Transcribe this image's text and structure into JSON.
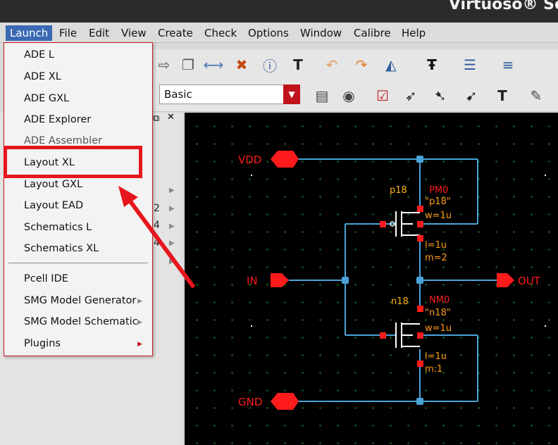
{
  "window": {
    "title": "Virtuoso® Sc"
  },
  "menubar": [
    "Launch",
    "File",
    "Edit",
    "View",
    "Create",
    "Check",
    "Options",
    "Window",
    "Calibre",
    "Help"
  ],
  "toolbar": {
    "filter_combo": "Basic"
  },
  "launch_menu": {
    "items": [
      "ADE L",
      "ADE XL",
      "ADE GXL",
      "ADE Explorer",
      "ADE Assembler",
      "Layout XL",
      "Layout GXL",
      "Layout EAD",
      "Schematics L",
      "Schematics XL",
      "Pcell IDE",
      "SMG Model Generator",
      "SMG Model Schematic",
      "Plugins"
    ],
    "highlighted": "Layout XL"
  },
  "left_pane": {
    "visible_numbers": [
      "2",
      "4",
      "4"
    ]
  },
  "schematic": {
    "pins": {
      "vdd": "VDD",
      "in": "IN",
      "out": "OUT",
      "gnd": "GND"
    },
    "pmos": {
      "model": "p18",
      "instance": "PM0",
      "cell": "\"p18\"",
      "width": "w=1u",
      "length": "l=1u",
      "mult": "m=2"
    },
    "nmos": {
      "model": "n18",
      "instance": "NM0",
      "cell": "\"n18\"",
      "width": "w=1u",
      "length": "l=1u",
      "mult": "m:1"
    }
  },
  "colors": {
    "accent_red": "#e8151d",
    "wire": "#4aa3d8",
    "pin_red": "#ff1b1b",
    "label_orange": "#ff9a1a",
    "grid": "#1b8a2a",
    "menu_highlight": "#3b6ab4"
  }
}
